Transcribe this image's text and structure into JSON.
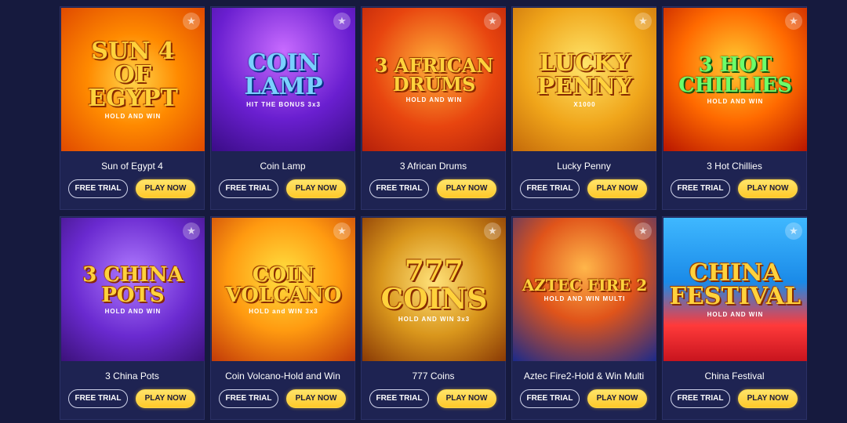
{
  "buttons": {
    "free_trial": "FREE TRIAL",
    "play_now": "PLAY NOW"
  },
  "games": [
    {
      "title": "Sun of Egypt 4",
      "art": "SUN 4\nOF\nEGYPT",
      "sub": "HOLD AND WIN",
      "bg": "radial-gradient(circle at 50% 50%, #ffd54a 0%, #ff8a00 45%, #e04a00 100%)",
      "tone": ""
    },
    {
      "title": "Coin Lamp",
      "art": "COIN\nLAMP",
      "sub": "HIT THE BONUS 3x3",
      "bg": "radial-gradient(circle at 50% 30%, #c86bff 0%, #6a1fd0 55%, #3a0c86 100%)",
      "tone": "blue"
    },
    {
      "title": "3 African Drums",
      "art": "3 AFRICAN\nDRUMS",
      "sub": "HOLD AND WIN",
      "bg": "radial-gradient(circle at 50% 40%, #ffb13a 0%, #e8450f 55%, #b5200a 100%)",
      "tone": ""
    },
    {
      "title": "Lucky Penny",
      "art": "LUCKY\nPENNY",
      "sub": "X1000",
      "bg": "radial-gradient(circle at 50% 40%, #ffe56a 0%, #f0a51a 55%, #c46a0a 100%)",
      "tone": ""
    },
    {
      "title": "3 Hot Chillies",
      "art": "3 HOT\nCHILLIES",
      "sub": "HOLD AND WIN",
      "bg": "radial-gradient(circle at 50% 40%, #ffcc33 0%, #ff6a00 50%, #b81500 100%)",
      "tone": "green"
    },
    {
      "title": "3 China Pots",
      "art": "3 CHINA\nPOTS",
      "sub": "HOLD AND WIN",
      "bg": "radial-gradient(circle at 50% 40%, #b07bff 0%, #6a2ad0 55%, #3c117a 100%)",
      "tone": ""
    },
    {
      "title": "Coin Volcano-Hold and Win",
      "art": "COIN\nVOLCANO",
      "sub": "HOLD and WIN 3x3",
      "bg": "radial-gradient(circle at 50% 40%, #ffe040 0%, #ff9a10 50%, #c23a08 100%)",
      "tone": ""
    },
    {
      "title": "777 Coins",
      "art": "777\nCOINS",
      "sub": "HOLD AND WIN 3x3",
      "bg": "radial-gradient(circle at 50% 45%, #ffe27a 0%, #d9961c 50%, #8a3a05 100%)",
      "tone": ""
    },
    {
      "title": "Aztec Fire2-Hold & Win Multi",
      "art": "AZTEC FIRE 2",
      "sub": "HOLD AND WIN MULTI",
      "bg": "radial-gradient(circle at 50% 35%, #ffb64a 0%, #e0541a 45%, #1b2a8a 100%)",
      "tone": ""
    },
    {
      "title": "China Festival",
      "art": "CHINA\nFESTIVAL",
      "sub": "HOLD AND WIN",
      "bg": "linear-gradient(#3fb8ff 0%, #1a8ae8 45%, #ff3a3a 75%, #c8141e 100%)",
      "tone": ""
    }
  ]
}
